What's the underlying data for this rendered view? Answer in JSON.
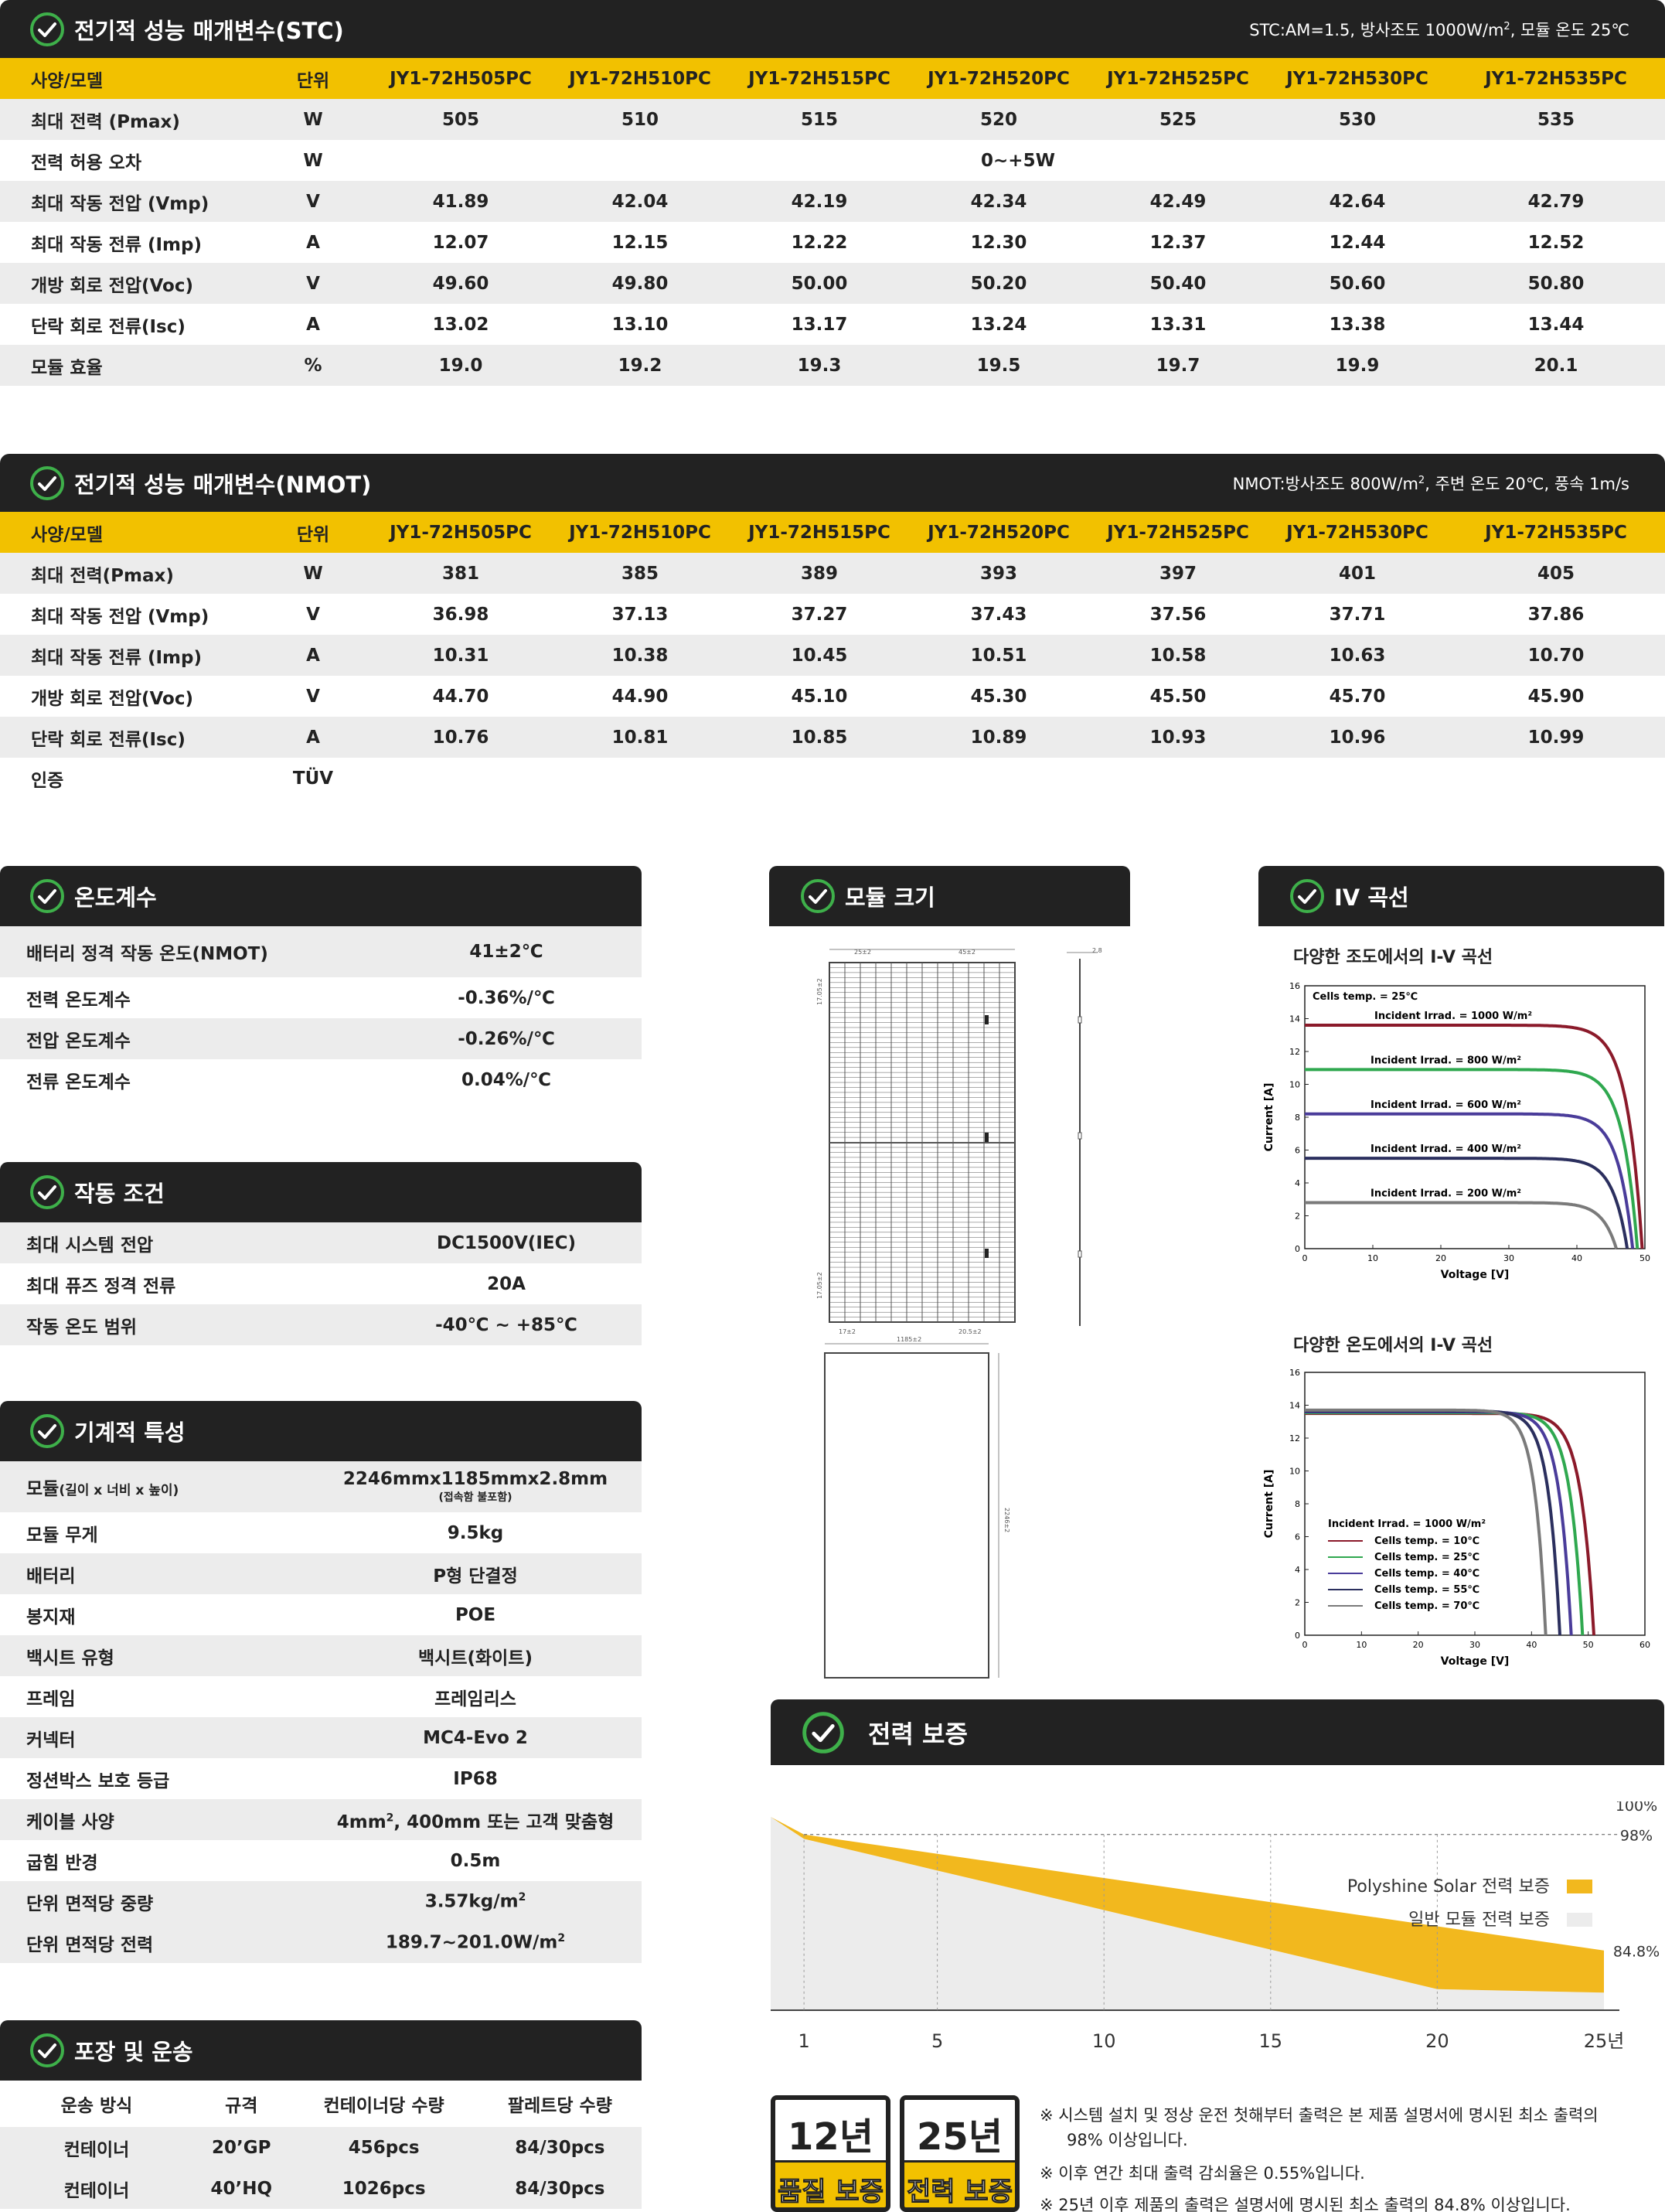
{
  "stc": {
    "title": "전기적 성능 매개변수(STC)",
    "note_a": "STC:AM=1.5, 방사조도 1000W/m",
    "note_sup": "2",
    "note_b": ", 모듈 온도 25℃",
    "header": [
      "사양/모델",
      "단위",
      "JY1-72H505PC",
      "JY1-72H510PC",
      "JY1-72H515PC",
      "JY1-72H520PC",
      "JY1-72H525PC",
      "JY1-72H530PC",
      "JY1-72H535PC"
    ],
    "rows": [
      [
        "최대 전력 (Pmax)",
        "W",
        "505",
        "510",
        "515",
        "520",
        "525",
        "530",
        "535"
      ],
      [
        "최대 작동 전압 (Vmp)",
        "V",
        "41.89",
        "42.04",
        "42.19",
        "42.34",
        "42.49",
        "42.64",
        "42.79"
      ],
      [
        "최대 작동 전류 (Imp)",
        "A",
        "12.07",
        "12.15",
        "12.22",
        "12.30",
        "12.37",
        "12.44",
        "12.52"
      ],
      [
        "개방 회로 전압(Voc)",
        "V",
        "49.60",
        "49.80",
        "50.00",
        "50.20",
        "50.40",
        "50.60",
        "50.80"
      ],
      [
        "단락 회로 전류(Isc)",
        "A",
        "13.02",
        "13.10",
        "13.17",
        "13.24",
        "13.31",
        "13.38",
        "13.44"
      ],
      [
        "모듈 효율",
        "%",
        "19.0",
        "19.2",
        "19.3",
        "19.5",
        "19.7",
        "19.9",
        "20.1"
      ]
    ],
    "tolerance": {
      "label": "전력 허용 오차",
      "unit": "W",
      "value": "0~+5W"
    }
  },
  "nmot": {
    "title": "전기적 성능 매개변수(NMOT)",
    "note_a": "NMOT:방사조도 800W/m",
    "note_sup": "2",
    "note_b": ", 주변 온도 20℃, 풍속 1m/s",
    "header": [
      "사양/모델",
      "단위",
      "JY1-72H505PC",
      "JY1-72H510PC",
      "JY1-72H515PC",
      "JY1-72H520PC",
      "JY1-72H525PC",
      "JY1-72H530PC",
      "JY1-72H535PC"
    ],
    "rows": [
      [
        "최대 전력(Pmax)",
        "W",
        "381",
        "385",
        "389",
        "393",
        "397",
        "401",
        "405"
      ],
      [
        "최대 작동 전압 (Vmp)",
        "V",
        "36.98",
        "37.13",
        "37.27",
        "37.43",
        "37.56",
        "37.71",
        "37.86"
      ],
      [
        "최대 작동 전류 (Imp)",
        "A",
        "10.31",
        "10.38",
        "10.45",
        "10.51",
        "10.58",
        "10.63",
        "10.70"
      ],
      [
        "개방 회로 전압(Voc)",
        "V",
        "44.70",
        "44.90",
        "45.10",
        "45.30",
        "45.50",
        "45.70",
        "45.90"
      ],
      [
        "단락 회로 전류(Isc)",
        "A",
        "10.76",
        "10.81",
        "10.85",
        "10.89",
        "10.93",
        "10.96",
        "10.99"
      ]
    ],
    "cert": {
      "label": "인증",
      "value": "TÜV"
    }
  },
  "temp": {
    "title": "온도계수",
    "rows": [
      [
        "배터리 정격 작동 온도(NMOT)",
        "41±2℃"
      ],
      [
        "전력 온도계수",
        "-0.36%/℃"
      ],
      [
        "전압 온도계수",
        "-0.26%/℃"
      ],
      [
        "전류 온도계수",
        "0.04%/℃"
      ]
    ]
  },
  "operating": {
    "title": "작동 조건",
    "rows": [
      [
        "최대 시스템 전압",
        "DC1500V(IEC)"
      ],
      [
        "최대 퓨즈 정격 전류",
        "20A"
      ],
      [
        "작동 온도 범위",
        "-40℃ ~ +85℃"
      ]
    ]
  },
  "mech": {
    "title": "기계적 특성",
    "module_label": "모듈",
    "module_label_sub": "(길이 x 너비 x 높이)",
    "module_value": "2246mmx1185mmx2.8mm",
    "module_value_sub": "(접속함 불포함)",
    "rows": [
      [
        "모듈 무게",
        "9.5kg"
      ],
      [
        "배터리",
        "P형 단결정"
      ],
      [
        "봉지재",
        "POE"
      ],
      [
        "백시트 유형",
        "백시트(화이트)"
      ],
      [
        "프레임",
        "프레임리스"
      ],
      [
        "커넥터",
        "MC4-Evo 2"
      ],
      [
        "정션박스 보호 등급",
        "IP68"
      ]
    ],
    "cable_label": "케이블 사양",
    "cable_a": "4mm",
    "cable_sup": "2",
    "cable_b": ", 400mm 또는 고객 맞춤형",
    "bend_label": "굽힘 반경",
    "bend_value": "0.5m",
    "weight_label": "단위 면적당 중량",
    "weight_a": "3.57kg/m",
    "weight_sup": "2",
    "power_label": "단위 면적당 전력",
    "power_a": "189.7~201.0W/m",
    "power_sup": "2"
  },
  "packing": {
    "title": "포장 및 운송",
    "header": [
      "운송 방식",
      "규격",
      "컨테이너당 수량",
      "팔레트당 수량"
    ],
    "rows": [
      [
        "컨테이너",
        "20’GP",
        "456pcs",
        "84/30pcs"
      ],
      [
        "컨테이너",
        "40’HQ",
        "1026pcs",
        "84/30pcs"
      ]
    ]
  },
  "module_size": {
    "title": "모듈 크기",
    "dims": [
      "25±2",
      "45±2",
      "2.8",
      "17.05±2",
      "17±2",
      "20.5±2",
      "17.05±2",
      "1185±2",
      "2246±2"
    ]
  },
  "iv": {
    "title": "IV 곡선",
    "chart1_title": "다양한 조도에서의 I-V 곡선",
    "chart2_title": "다양한 온도에서의 I-V 곡선",
    "ylabel": "Current [A]",
    "xlabel": "Voltage [V]"
  },
  "warranty": {
    "title": "전력 보증",
    "legend_solar": "Polyshine Solar 전력 보증",
    "legend_general": "일반 모듈 전력 보증",
    "badge1_year": "12년",
    "badge1_text": "품질 보증",
    "badge2_year": "25년",
    "badge2_text": "전력 보증",
    "notes": [
      "※ 시스템 설치 및 정상 운전 첫해부터 출력은 본 제품 설명서에 명시된 최소 출력의",
      "98% 이상입니다.",
      "※ 이후 연간 최대 출력 감쇠율은 0.55%입니다.",
      "※ 25년 이후 제품의 출력은 설명서에 명시된 최소 출력의 84.8% 이상입니다."
    ]
  },
  "chart_data": [
    {
      "type": "line",
      "title": "다양한 조도에서의 I-V 곡선",
      "xlabel": "Voltage [V]",
      "ylabel": "Current [A]",
      "xlim": [
        0,
        50
      ],
      "ylim": [
        0,
        16
      ],
      "xticks": [
        0,
        10,
        20,
        30,
        40,
        50
      ],
      "yticks": [
        0,
        2,
        4,
        6,
        8,
        10,
        12,
        14,
        16
      ],
      "annotation": "Cells temp. = 25℃",
      "series": [
        {
          "name": "Incident Irrad. = 1000 W/m²",
          "color": "#8b1a2a",
          "isc": 13.6,
          "voc": 49.6
        },
        {
          "name": "Incident Irrad. = 800 W/m²",
          "color": "#2fa84f",
          "isc": 10.9,
          "voc": 48.9
        },
        {
          "name": "Incident Irrad. = 600 W/m²",
          "color": "#4a3c9a",
          "isc": 8.2,
          "voc": 48.2
        },
        {
          "name": "Incident Irrad. = 400 W/m²",
          "color": "#2b2f5e",
          "isc": 5.5,
          "voc": 47.4
        },
        {
          "name": "Incident Irrad. = 200 W/m²",
          "color": "#7a7a7a",
          "isc": 2.8,
          "voc": 45.8
        }
      ]
    },
    {
      "type": "line",
      "title": "다양한 온도에서의 I-V 곡선",
      "xlabel": "Voltage [V]",
      "ylabel": "Current [A]",
      "xlim": [
        0,
        60
      ],
      "ylim": [
        0,
        16
      ],
      "xticks": [
        0,
        10,
        20,
        30,
        40,
        50,
        60
      ],
      "yticks": [
        0,
        2,
        4,
        6,
        8,
        10,
        12,
        14,
        16
      ],
      "annotation": "Incident Irrad. = 1000 W/m²",
      "series": [
        {
          "name": "Cells temp. = 10℃",
          "color": "#8b1a2a",
          "isc": 13.5,
          "voc": 51.0
        },
        {
          "name": "Cells temp. = 25℃",
          "color": "#2fa84f",
          "isc": 13.55,
          "voc": 49.0
        },
        {
          "name": "Cells temp. = 40℃",
          "color": "#4a3c9a",
          "isc": 13.6,
          "voc": 47.0
        },
        {
          "name": "Cells temp. = 55℃",
          "color": "#2b2f5e",
          "isc": 13.65,
          "voc": 45.0
        },
        {
          "name": "Cells temp. = 70℃",
          "color": "#7a7a7a",
          "isc": 13.7,
          "voc": 42.5
        }
      ]
    },
    {
      "type": "area",
      "x": [
        0,
        1,
        5,
        10,
        15,
        20,
        25
      ],
      "xticks": [
        "1",
        "5",
        "10",
        "15",
        "20",
        "25년"
      ],
      "ylabels": [
        "100%",
        "98%",
        "84.8%"
      ],
      "series": [
        {
          "name": "Polyshine Solar 전력 보증",
          "color": "#f2b81e",
          "upper": [
            100,
            98,
            95.8,
            93.05,
            90.3,
            87.55,
            84.8
          ]
        },
        {
          "name": "일반 모듈 전력 보증",
          "color": "#ececec",
          "upper": [
            100,
            97.5,
            93.9,
            89.4,
            84.9,
            80.4,
            80.0
          ]
        }
      ]
    }
  ]
}
